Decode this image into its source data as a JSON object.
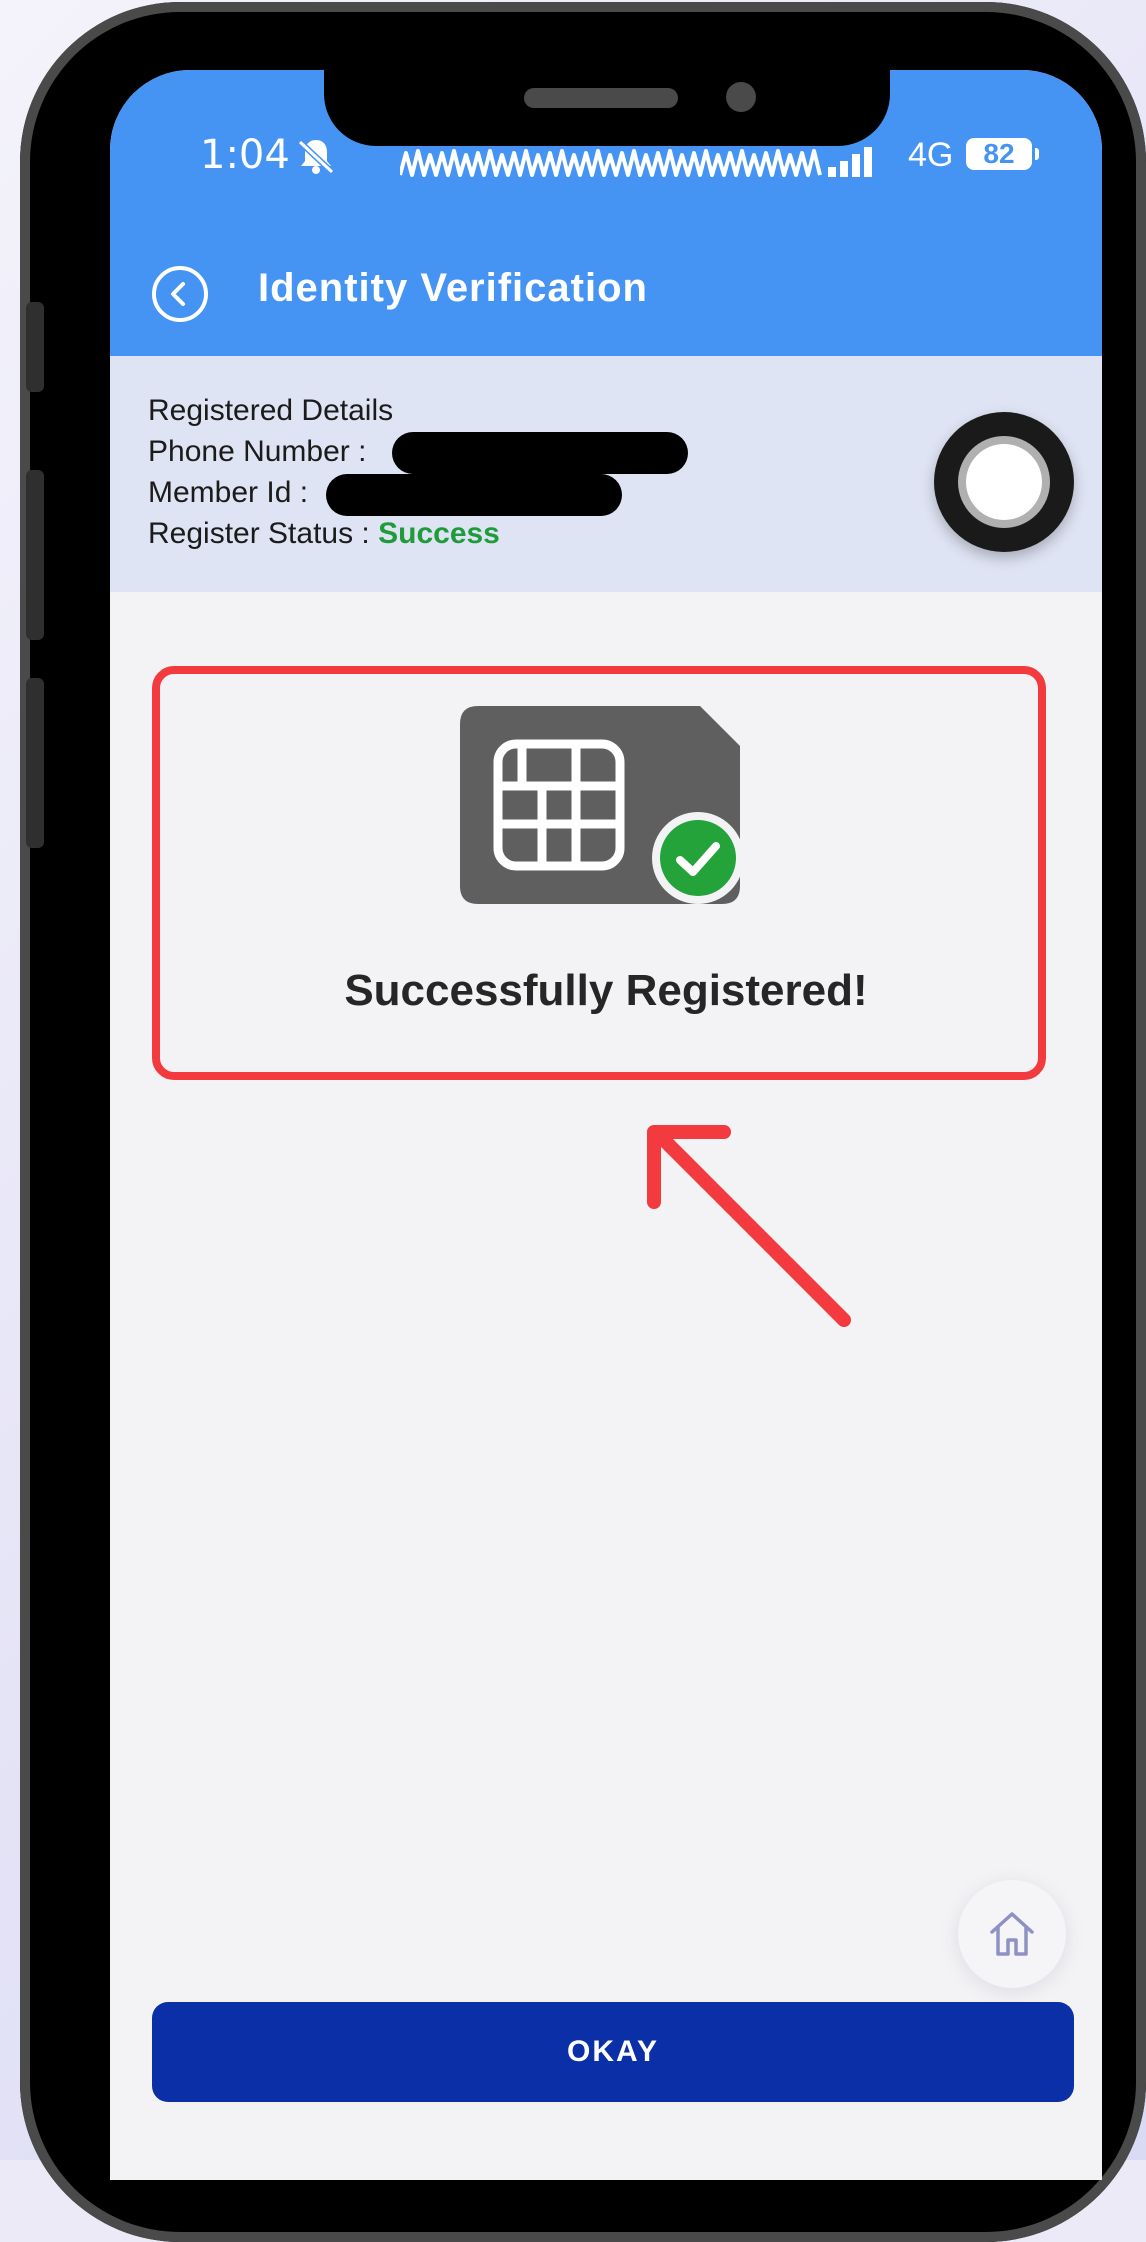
{
  "status_bar": {
    "time": "1:04",
    "network": "4G",
    "battery": "82"
  },
  "header": {
    "title": "Identity Verification"
  },
  "details": {
    "heading": "Registered Details",
    "phone_label": "Phone Number :",
    "member_label": "Member Id :",
    "status_label": "Register Status :",
    "status_value": "Success"
  },
  "result": {
    "message": "Successfully Registered!"
  },
  "footer": {
    "okay_label": "OKAY"
  },
  "colors": {
    "header_blue": "#4594f3",
    "success_green": "#1f9b3b",
    "highlight_red": "#f33a3e",
    "button_blue": "#0a2fa7"
  },
  "icons": {
    "back": "chevron-left-icon",
    "mute": "bell-off-icon",
    "sim": "sim-card-icon",
    "check": "check-circle-icon",
    "arrow": "arrow-up-left-icon",
    "home": "home-icon"
  }
}
